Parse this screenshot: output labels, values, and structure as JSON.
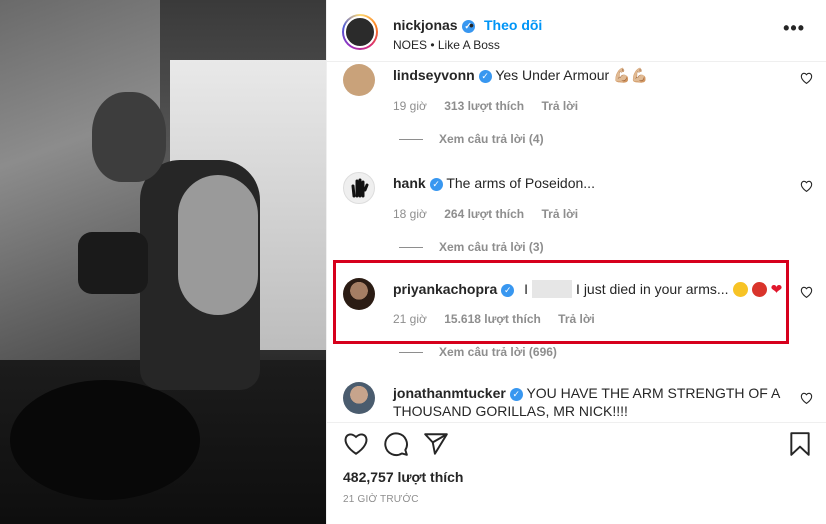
{
  "post": {
    "username": "nickjonas",
    "follow_label": "Theo dõi",
    "subtitle": "NOES • Like A Boss",
    "more_label": "•••"
  },
  "comments": [
    {
      "username": "lindseyvonn",
      "text": "Yes Under Armour 💪🏼💪🏼",
      "time": "19 giờ",
      "likes": "313 lượt thích",
      "reply_label": "Trả lời",
      "replies_label": "Xem câu trả lời (4)"
    },
    {
      "username": "hank",
      "text": "The arms of Poseidon...",
      "time": "18 giờ",
      "likes": "264 lượt thích",
      "reply_label": "Trả lời",
      "replies_label": "Xem câu trả lời (3)"
    },
    {
      "username": "priyankachopra",
      "text_prefix": "I",
      "text": "I just died in your arms...",
      "time": "21 giờ",
      "likes": "15.618 lượt thích",
      "reply_label": "Trả lời",
      "replies_label": "Xem câu trả lời (696)"
    },
    {
      "username": "jonathanmtucker",
      "text": "YOU HAVE THE ARM STRENGTH OF A",
      "text_line2": "THOUSAND GORILLAS, MR NICK!!!!"
    }
  ],
  "footer": {
    "likes": "482,757 lượt thích",
    "time": "21 GIỜ TRƯỚC"
  },
  "colors": {
    "accent": "#0095f6",
    "verified": "#3897f0",
    "highlight": "#d6001c",
    "muted": "#8e8e8e"
  },
  "icons": [
    "verified-badge-icon",
    "heart-icon",
    "comment-icon",
    "share-icon",
    "bookmark-icon",
    "more-icon"
  ]
}
